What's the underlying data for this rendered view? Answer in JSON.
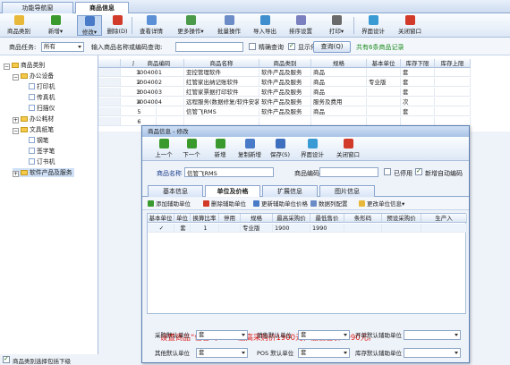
{
  "tabs": [
    {
      "label": "功能导航窗"
    },
    {
      "label": "商品信息"
    }
  ],
  "toolbar": {
    "items": [
      {
        "label": "商品类别",
        "icon": "folder-icon",
        "color": "#e8b83a"
      },
      {
        "label": "新增▾",
        "icon": "add-icon",
        "color": "#3b9a2e"
      },
      {
        "label": "修改▾",
        "icon": "edit-icon",
        "color": "#4a7bc8"
      },
      {
        "label": "删除(D)",
        "icon": "delete-icon",
        "color": "#d23a2a"
      },
      {
        "label": "查看详情",
        "icon": "detail-icon",
        "color": "#5b8fd6"
      },
      {
        "label": "更多操作▾",
        "icon": "more-icon",
        "color": "#4a9a4a"
      },
      {
        "label": "批量操作",
        "icon": "batch-icon",
        "color": "#6b8cc7"
      },
      {
        "label": "导入导出",
        "icon": "import-export-icon",
        "color": "#3f8fce"
      },
      {
        "label": "排序设置",
        "icon": "sort-icon",
        "color": "#7a7fbf"
      },
      {
        "label": "打印▾",
        "icon": "print-icon",
        "color": "#6a6a6a"
      },
      {
        "label": "界面设计",
        "icon": "design-icon",
        "color": "#3a9ad4"
      },
      {
        "label": "关闭窗口",
        "icon": "close-window-icon",
        "color": "#d23a2a"
      }
    ]
  },
  "filter": {
    "category_label": "商品任务:",
    "category_value": "所有",
    "search_label": "输入商品名称或编码查询:",
    "search_value": "",
    "exact_label": "精确查询",
    "show_disabled_label": "显示停用商品",
    "query_button": "查询(Q)",
    "record_count": "共有6条商品记录",
    "record_count_color": "#1b8a1b"
  },
  "tree": {
    "root": "商品类别",
    "nodes": [
      {
        "label": "办公设备",
        "type": "folder",
        "level": 1,
        "expanded": true
      },
      {
        "label": "打印机",
        "type": "leaf",
        "level": 2
      },
      {
        "label": "传真机",
        "type": "leaf",
        "level": 2
      },
      {
        "label": "扫描仪",
        "type": "leaf",
        "level": 2
      },
      {
        "label": "办公耗材",
        "type": "folder",
        "level": 1,
        "expanded": false
      },
      {
        "label": "文具纸笔",
        "type": "folder",
        "level": 1,
        "expanded": true
      },
      {
        "label": "钢笔",
        "type": "leaf",
        "level": 2
      },
      {
        "label": "签字笔",
        "type": "leaf",
        "level": 2
      },
      {
        "label": "订书机",
        "type": "leaf",
        "level": 2
      },
      {
        "label": "软件产品及服务",
        "type": "folder",
        "level": 1,
        "expanded": false,
        "selected": true
      }
    ],
    "bottom_checkbox": "商品类别选择包括下级"
  },
  "grid": {
    "headers": [
      "序号",
      "商品编码",
      "商品名称",
      "商品类别",
      "规格",
      "基本单位",
      "库存下限",
      "库存上限"
    ],
    "rows": [
      [
        "1",
        "1004001",
        "亚控管理软件",
        "软件产品及服务",
        "商品",
        "",
        "套",
        ""
      ],
      [
        "2",
        "1004002",
        "红管家出纳记账软件",
        "软件产品及服务",
        "商品",
        "专业版",
        "套",
        ""
      ],
      [
        "3",
        "1004003",
        "红管家票据打印软件",
        "软件产品及服务",
        "商品",
        "",
        "套",
        ""
      ],
      [
        "4",
        "1004004",
        "远程服务(数据修复/软件安装)",
        "软件产品及服务",
        "服务及费用",
        "",
        "次",
        ""
      ],
      [
        "5",
        "",
        "信管飞RMS",
        "软件产品及服务",
        "商品",
        "",
        "套",
        ""
      ],
      [
        "6",
        "",
        "",
        "",
        "",
        "",
        "",
        ""
      ]
    ]
  },
  "dialog": {
    "title": "商品信息 - 修改",
    "toolbar": [
      {
        "label": "上一个",
        "icon": "prev-icon",
        "color": "#3b9a2e"
      },
      {
        "label": "下一个",
        "icon": "next-icon",
        "color": "#3b9a2e"
      },
      {
        "label": "新增",
        "icon": "add-icon",
        "color": "#3b9a2e"
      },
      {
        "label": "复制新增",
        "icon": "copy-add-icon",
        "color": "#4a7bc8"
      },
      {
        "label": "保存(S)",
        "icon": "save-icon",
        "color": "#3f6fbf"
      },
      {
        "label": "界面设计",
        "icon": "design-icon",
        "color": "#3a9ad4"
      },
      {
        "label": "关闭窗口",
        "icon": "close-window-icon",
        "color": "#d23a2a"
      }
    ],
    "name_label": "商品名称",
    "name_value": "信管飞RMS",
    "code_label": "商品编码",
    "code_value": "",
    "disabled_label": "已停用",
    "auto_code_label": "新增自动编码",
    "tabs": [
      "基本信息",
      "单位及价格",
      "扩展信息",
      "图片信息"
    ],
    "subtoolbar": [
      {
        "label": "添加辅助单位",
        "icon": "add-unit-icon",
        "color": "#3b9a2e"
      },
      {
        "label": "删除辅助单位",
        "icon": "delete-unit-icon",
        "color": "#d23a2a"
      },
      {
        "label": "更新辅助单位价格",
        "icon": "update-price-icon",
        "color": "#4a7bc8"
      },
      {
        "label": "数据列配置",
        "icon": "column-config-icon",
        "color": "#6b8cc7"
      },
      {
        "label": "更改单位信息▾",
        "icon": "change-unit-icon",
        "color": "#e8b83a"
      }
    ],
    "unit_headers": [
      "基本单位",
      "单位",
      "换算比率",
      "停用",
      "规格",
      "最高采购价",
      "最低售价",
      "条形码",
      "预设采购价",
      "生产入"
    ],
    "unit_row": [
      "✓",
      "套",
      "1",
      "",
      "专业版",
      "1900",
      "1990",
      "",
      "",
      ""
    ],
    "annotation": "设置商品“信管飞RMS”最高采购价1900元，最低售价1990元。",
    "annotation_color": "#e0201c",
    "bottom_fields": [
      {
        "label": "采购默认单位",
        "value": "套"
      },
      {
        "label": "销售默认单位",
        "value": "套"
      },
      {
        "label": "开单默认辅助单位",
        "value": ""
      },
      {
        "label": "其他默认单位",
        "value": "套"
      },
      {
        "label": "POS 默认单位",
        "value": "套"
      },
      {
        "label": "库存默认辅助单位",
        "value": ""
      }
    ]
  }
}
